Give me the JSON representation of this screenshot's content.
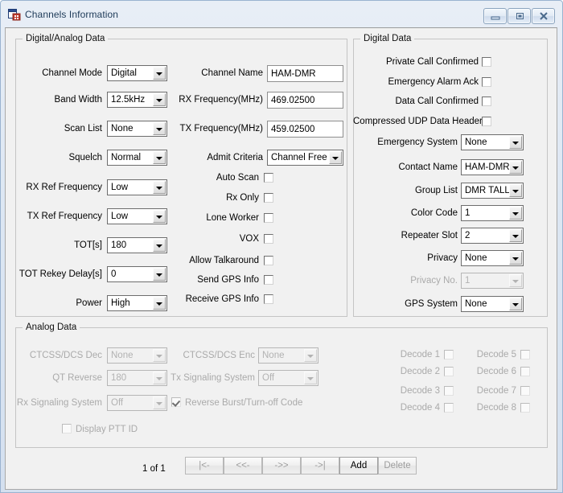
{
  "window": {
    "title": "Channels Information",
    "icon": "form-window-icon",
    "controls": {
      "minimize": "minimize-icon",
      "maximize": "maximize-icon",
      "close": "close-icon"
    }
  },
  "groups": {
    "digital_analog": "Digital/Analog Data",
    "digital": "Digital Data",
    "analog": "Analog Data"
  },
  "digital_analog": {
    "left_fields": [
      {
        "label": "Channel Mode",
        "value": "Digital"
      },
      {
        "label": "Band Width",
        "value": "12.5kHz"
      },
      {
        "label": "Scan List",
        "value": "None"
      },
      {
        "label": "Squelch",
        "value": "Normal"
      },
      {
        "label": "RX Ref Frequency",
        "value": "Low"
      },
      {
        "label": "TX Ref Frequency",
        "value": "Low"
      },
      {
        "label": "TOT[s]",
        "value": "180"
      },
      {
        "label": "TOT Rekey Delay[s]",
        "value": "0"
      },
      {
        "label": "Power",
        "value": "High"
      }
    ],
    "mid_text_fields": [
      {
        "label": "Channel Name",
        "value": "HAM-DMR"
      },
      {
        "label": "RX Frequency(MHz)",
        "value": "469.02500"
      },
      {
        "label": "TX Frequency(MHz)",
        "value": "459.02500"
      }
    ],
    "mid_combo": {
      "label": "Admit Criteria",
      "value": "Channel Free"
    },
    "mid_checks": [
      {
        "label": "Auto Scan",
        "checked": false
      },
      {
        "label": "Rx Only",
        "checked": false
      },
      {
        "label": "Lone Worker",
        "checked": false
      },
      {
        "label": "VOX",
        "checked": false
      },
      {
        "label": "Allow Talkaround",
        "checked": false
      },
      {
        "label": "Send GPS Info",
        "checked": false
      },
      {
        "label": "Receive GPS Info",
        "checked": false
      }
    ]
  },
  "digital": {
    "checks": [
      {
        "label": "Private Call Confirmed",
        "checked": false
      },
      {
        "label": "Emergency Alarm Ack",
        "checked": false
      },
      {
        "label": "Data Call Confirmed",
        "checked": false
      },
      {
        "label": "Compressed UDP Data Header",
        "checked": false
      }
    ],
    "combos": [
      {
        "label": "Emergency System",
        "value": "None",
        "disabled": false
      },
      {
        "label": "Contact Name",
        "value": "HAM-DMR",
        "disabled": false
      },
      {
        "label": "Group List",
        "value": "DMR TALLIN",
        "disabled": false
      },
      {
        "label": "Color Code",
        "value": "1",
        "disabled": false
      },
      {
        "label": "Repeater Slot",
        "value": "2",
        "disabled": false
      },
      {
        "label": "Privacy",
        "value": "None",
        "disabled": false
      },
      {
        "label": "Privacy No.",
        "value": "1",
        "disabled": true
      },
      {
        "label": "GPS System",
        "value": "None",
        "disabled": false
      }
    ]
  },
  "analog": {
    "left_combos": [
      {
        "label": "CTCSS/DCS Dec",
        "value": "None"
      },
      {
        "label": "QT Reverse",
        "value": "180"
      },
      {
        "label": "Rx Signaling System",
        "value": "Off"
      }
    ],
    "right_combos": [
      {
        "label": "CTCSS/DCS Enc",
        "value": "None"
      },
      {
        "label": "Tx Signaling System",
        "value": "Off"
      }
    ],
    "reverse_burst": {
      "label": "Reverse Burst/Turn-off Code",
      "checked": true
    },
    "display_ptt": {
      "label": "Display PTT ID",
      "checked": false
    },
    "decodes": [
      {
        "label": "Decode 1",
        "checked": false
      },
      {
        "label": "Decode 2",
        "checked": false
      },
      {
        "label": "Decode 3",
        "checked": false
      },
      {
        "label": "Decode 4",
        "checked": false
      },
      {
        "label": "Decode 5",
        "checked": false
      },
      {
        "label": "Decode 6",
        "checked": false
      },
      {
        "label": "Decode 7",
        "checked": false
      },
      {
        "label": "Decode 8",
        "checked": false
      }
    ]
  },
  "footer": {
    "page_label": "1 of 1",
    "buttons": [
      {
        "name": "first",
        "label": "|<-",
        "enabled": false
      },
      {
        "name": "previous",
        "label": "<<-",
        "enabled": false
      },
      {
        "name": "next",
        "label": "->>",
        "enabled": false
      },
      {
        "name": "last",
        "label": "->|",
        "enabled": false
      },
      {
        "name": "add",
        "label": "Add",
        "enabled": true
      },
      {
        "name": "delete",
        "label": "Delete",
        "enabled": false
      }
    ]
  }
}
